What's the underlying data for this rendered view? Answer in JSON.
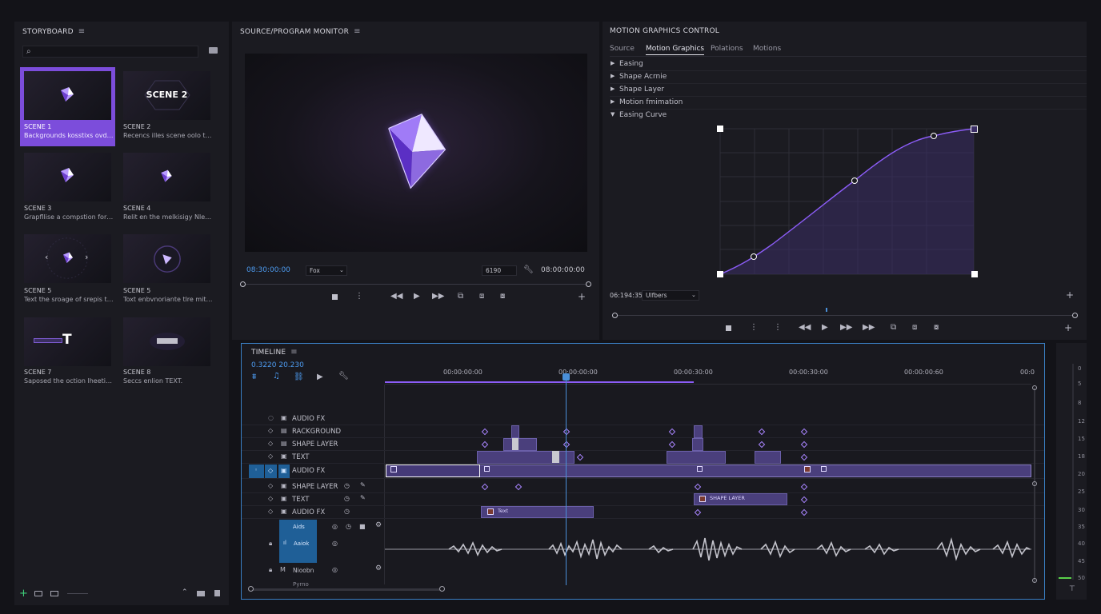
{
  "storyboard": {
    "title": "STORYBOARD",
    "search_placeholder": "",
    "scenes": [
      {
        "name": "SCENE 1",
        "desc": "Backgrounds kosstixs ovd In..."
      },
      {
        "name": "SCENE 2",
        "desc": "Recencs illes scene oolo the ...",
        "thumb_text": "SCENE 2"
      },
      {
        "name": "SCENE 3",
        "desc": "Grapfllise a compstion for r..."
      },
      {
        "name": "SCENE 4",
        "desc": "Relit en the melkisigy Nlee d..."
      },
      {
        "name": "SCENE 5",
        "desc": "Text the sroage of srepis to ..."
      },
      {
        "name": "SCENE 5",
        "desc": "Toxt enbvnoriante tlre mito..."
      },
      {
        "name": "SCENE 7",
        "desc": "Saposed the oction lheeti ..."
      },
      {
        "name": "SCENE 8",
        "desc": "Seccs enlion TEXT."
      }
    ],
    "zoom_value": ""
  },
  "monitor": {
    "title": "SOURCE/PROGRAM MONITOR",
    "timecode_current": "08:30:00:00",
    "zoom_select": "Fox",
    "resolution": "6190",
    "timecode_duration": "08:00:00:00"
  },
  "motion": {
    "title": "MOTION GRAPHICS CONTROL",
    "tabs": [
      "Source",
      "Motion Graphics",
      "Polations",
      "Motions"
    ],
    "active_tab": 1,
    "rows": [
      "Easing",
      "Shape Acrnie",
      "Shape Layer",
      "Motion fmimation",
      "Easing Curve"
    ],
    "timecode": "06:194:35",
    "dropdown": "Ulfbers"
  },
  "timeline": {
    "title": "TIMELINE",
    "timecode": "0.3220 20.230",
    "ruler": [
      "00:00:00:00",
      "00:00:00:00",
      "00:00:30:00",
      "00:00:30:00",
      "00:00:00:60",
      "00:0"
    ],
    "tracks": [
      "AUDIO FX",
      "RACKGROUND",
      "SHAPE LAYER",
      "TEXT",
      "AUDIO FX",
      "SHAPE LAYER",
      "TEXT",
      "AUDIO FX"
    ],
    "clip_text": "TEXT",
    "clip_shape": "SHAPE LAYER",
    "clip_audio_fx": "Text",
    "audio_track_a": "Aids",
    "audio_track_b": "Aaiok",
    "audio_track_c": "Nioobn",
    "audio_track_d": "Pyrno"
  },
  "vu_meter": {
    "labels": [
      "0",
      "5",
      "8",
      "12",
      "15",
      "18",
      "20",
      "25",
      "30",
      "35",
      "40",
      "45",
      "50",
      "55"
    ]
  },
  "colors": {
    "accent": "#8b5cf6",
    "selection": "#7c4ddb",
    "playhead": "#4a8fd8"
  }
}
